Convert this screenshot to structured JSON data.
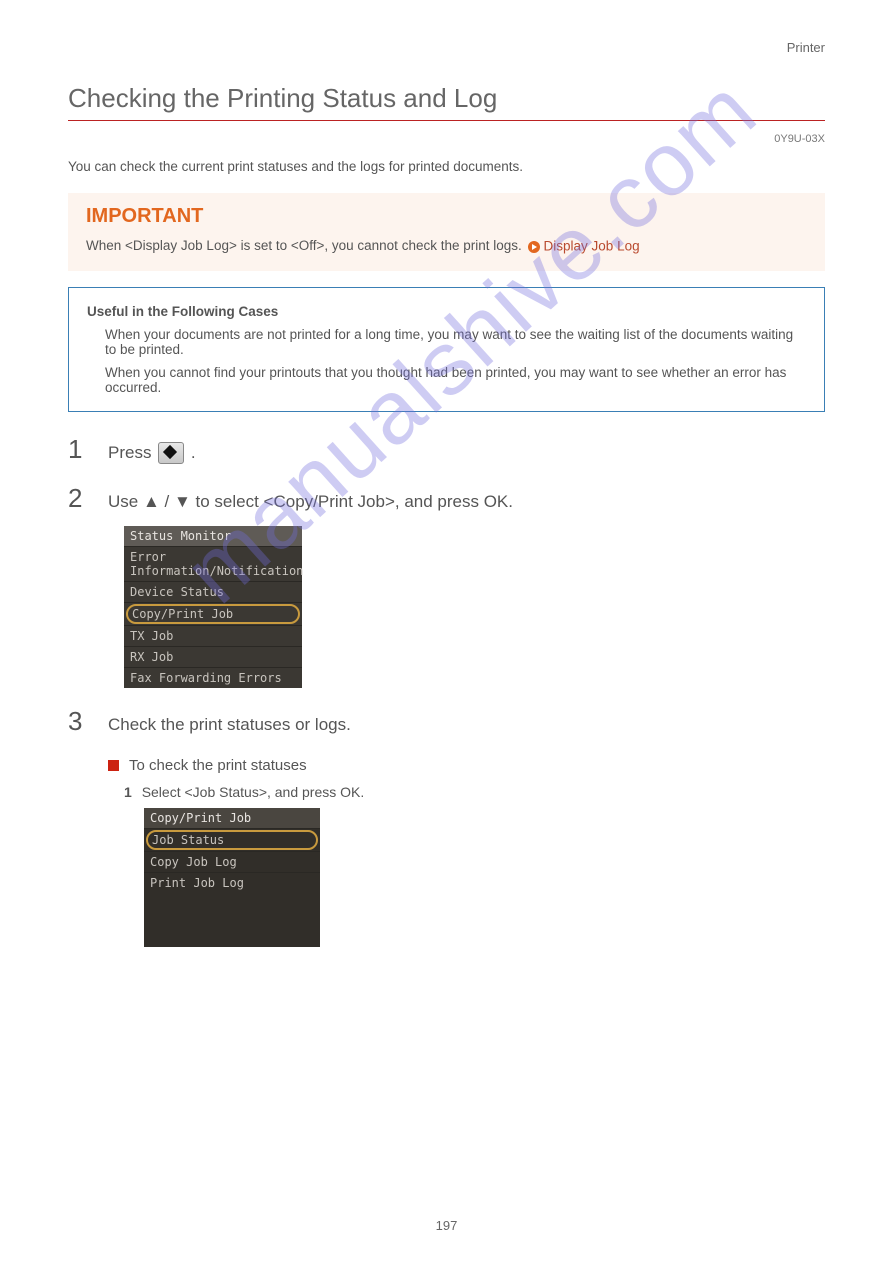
{
  "chapter": "Printer",
  "title": "Checking the Printing Status and Log",
  "code": "0Y9U-03X",
  "intro": "You can check the current print statuses and the logs for printed documents.",
  "important": {
    "label": "IMPORTANT",
    "text_before": "When <Display Job Log> is set to <Off>, you cannot check the print logs.",
    "link_text": "Display Job Log"
  },
  "toc": {
    "items": [
      "Useful in the Following Cases",
      "When your documents are not printed for a long time, you may want to see the waiting list of the documents waiting to be printed.",
      "When you cannot find your printouts that you thought had been printed, you may want to see whether an error has occurred."
    ]
  },
  "steps": [
    {
      "num": "1",
      "text_before": "Press ",
      "text_after": "."
    },
    {
      "num": "2",
      "text": "Use ▲ / ▼ to select <Copy/Print Job>, and press OK."
    },
    {
      "num": "3",
      "text": "Check the print statuses or logs."
    }
  ],
  "screenshot1": {
    "title": "Status Monitor",
    "items": [
      "Error Information/Notification",
      "Device Status",
      "Copy/Print Job",
      "TX Job",
      "RX Job",
      "Fax Forwarding Errors"
    ],
    "selected": 2
  },
  "subsection": {
    "title": "To check the print statuses",
    "step_num": "1",
    "step_text": "Select <Job Status>, and press OK."
  },
  "screenshot2": {
    "title": "Copy/Print Job",
    "items": [
      "Job Status",
      "Copy Job Log",
      "Print Job Log"
    ],
    "selected": 0
  },
  "page_number": "197",
  "watermark": "manualshive.com"
}
